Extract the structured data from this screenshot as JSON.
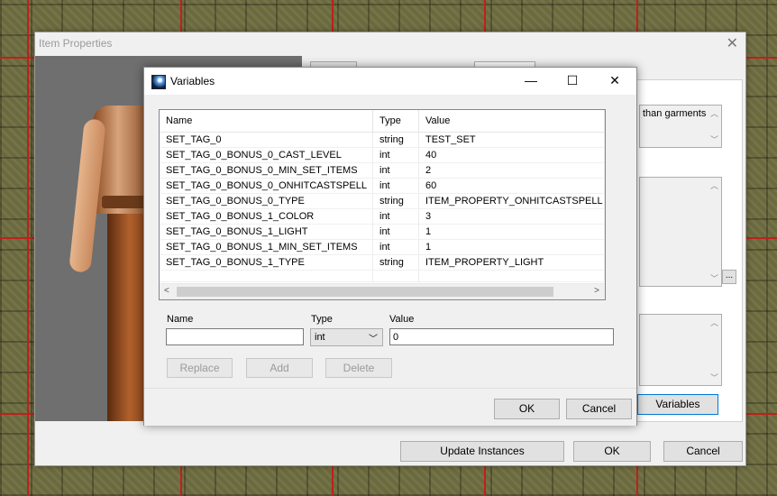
{
  "item_properties": {
    "title": "Item Properties",
    "description_fragment": "than garments",
    "ellipsis_label": "...",
    "variables_button": "Variables",
    "update_instances_button": "Update Instances",
    "ok_button": "OK",
    "cancel_button": "Cancel"
  },
  "variables_dialog": {
    "title": "Variables",
    "window_controls": {
      "minimize": "—",
      "maximize": "☐",
      "close": "✕"
    },
    "columns": [
      "Name",
      "Type",
      "Value"
    ],
    "rows": [
      {
        "name": "SET_TAG_0",
        "type": "string",
        "value": "TEST_SET"
      },
      {
        "name": "SET_TAG_0_BONUS_0_CAST_LEVEL",
        "type": "int",
        "value": "40"
      },
      {
        "name": "SET_TAG_0_BONUS_0_MIN_SET_ITEMS",
        "type": "int",
        "value": "2"
      },
      {
        "name": "SET_TAG_0_BONUS_0_ONHITCASTSPELL",
        "type": "int",
        "value": "60"
      },
      {
        "name": "SET_TAG_0_BONUS_0_TYPE",
        "type": "string",
        "value": "ITEM_PROPERTY_ONHITCASTSPELL"
      },
      {
        "name": "SET_TAG_0_BONUS_1_COLOR",
        "type": "int",
        "value": "3"
      },
      {
        "name": "SET_TAG_0_BONUS_1_LIGHT",
        "type": "int",
        "value": "1"
      },
      {
        "name": "SET_TAG_0_BONUS_1_MIN_SET_ITEMS",
        "type": "int",
        "value": "1"
      },
      {
        "name": "SET_TAG_0_BONUS_1_TYPE",
        "type": "string",
        "value": "ITEM_PROPERTY_LIGHT"
      }
    ],
    "editor": {
      "name_label": "Name",
      "name_value": "",
      "type_label": "Type",
      "type_value": "int",
      "value_label": "Value",
      "value_value": "0"
    },
    "buttons": {
      "replace": "Replace",
      "add": "Add",
      "delete": "Delete",
      "ok": "OK",
      "cancel": "Cancel"
    },
    "icons": [
      "app-icon",
      "chevron-down-icon",
      "scroll-left-icon",
      "scroll-right-icon"
    ]
  },
  "colors": {
    "grid_red": "#c0201a",
    "focus_blue": "#0078d7"
  }
}
